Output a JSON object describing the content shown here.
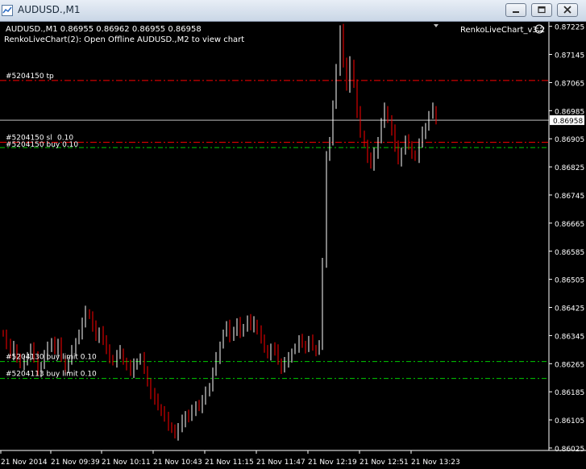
{
  "window": {
    "title": "AUDUSD.,M1",
    "buttons": [
      "minimize",
      "restore",
      "close"
    ]
  },
  "chart_header": {
    "symbol_line": "AUDUSD.,M1  0.86955 0.86962 0.86955 0.86958",
    "indicator_line": "RenkoLiveChart(2): Open Offline AUDUSD.,M2 to view chart",
    "ea_label": "RenkoLiveChart_v3.2",
    "ea_icon": "smiley-icon"
  },
  "colors": {
    "background": "#000000",
    "candle": "#ffffff",
    "candle_bear": "#ff0000",
    "tp_line": "#ff0000",
    "order_line": "#00cc00",
    "bid_line": "#c0c0c0",
    "bid_label_bg": "#ffffff"
  },
  "chart_data": {
    "type": "candlestick",
    "title": "AUDUSD.,M1",
    "y_ticks": [
      "0.87225",
      "0.87145",
      "0.87065",
      "0.86985",
      "0.86905",
      "0.86825",
      "0.86745",
      "0.86665",
      "0.86585",
      "0.86505",
      "0.86425",
      "0.86345",
      "0.86265",
      "0.86185",
      "0.86105",
      "0.86025"
    ],
    "x_ticks": [
      "21 Nov 2014",
      "21 Nov 09:39",
      "21 Nov 10:11",
      "21 Nov 10:43",
      "21 Nov 11:15",
      "21 Nov 11:47",
      "21 Nov 12:19",
      "21 Nov 12:51",
      "21 Nov 13:23"
    ],
    "ylim": [
      0.86018,
      0.87238
    ],
    "current_bid": "0.86958",
    "current_bid_value": 0.86958,
    "order_lines": [
      {
        "label": "#5204150 tp",
        "price": 0.87071,
        "kind": "tp"
      },
      {
        "label": "#5204150 sl",
        "price": 0.86895,
        "kind": "sl"
      },
      {
        "label": "#5204150 buy 0.10",
        "price": 0.8688,
        "kind": "order"
      },
      {
        "label": "#5204130 buy limit 0.10",
        "price": 0.86271,
        "kind": "pending"
      },
      {
        "label": "#5204113 buy limit 0.10",
        "price": 0.86223,
        "kind": "pending"
      }
    ],
    "sl_lot_text": "0.10",
    "close_series": [
      0.8635,
      0.8632,
      0.8629,
      0.8631,
      0.8628,
      0.8626,
      0.8627,
      0.8629,
      0.8631,
      0.8628,
      0.8624,
      0.8626,
      0.8629,
      0.8631,
      0.8633,
      0.863,
      0.8632,
      0.8628,
      0.8625,
      0.8627,
      0.863,
      0.8633,
      0.8635,
      0.8638,
      0.8641,
      0.864,
      0.8637,
      0.8634,
      0.8636,
      0.8633,
      0.863,
      0.8628,
      0.8627,
      0.8629,
      0.863,
      0.8627,
      0.8626,
      0.8624,
      0.8626,
      0.8627,
      0.8628,
      0.8625,
      0.8621,
      0.8618,
      0.8616,
      0.8614,
      0.8613,
      0.8611,
      0.8609,
      0.8608,
      0.8606,
      0.8608,
      0.861,
      0.8612,
      0.8611,
      0.8613,
      0.8615,
      0.8614,
      0.8616,
      0.8618,
      0.862,
      0.8624,
      0.8628,
      0.8632,
      0.8635,
      0.8637,
      0.8634,
      0.8636,
      0.8638,
      0.8635,
      0.8637,
      0.8639,
      0.8637,
      0.8638,
      0.8636,
      0.8633,
      0.8631,
      0.8629,
      0.8631,
      0.863,
      0.8627,
      0.8625,
      0.8627,
      0.8628,
      0.863,
      0.8631,
      0.8633,
      0.8632,
      0.8631,
      0.8633,
      0.8631,
      0.863,
      0.8632,
      0.8655,
      0.8685,
      0.869,
      0.87,
      0.871,
      0.8722,
      0.8712,
      0.8705,
      0.8712,
      0.8706,
      0.8698,
      0.8692,
      0.8689,
      0.8685,
      0.8683,
      0.8686,
      0.869,
      0.8695,
      0.8699,
      0.8696,
      0.8693,
      0.8688,
      0.8684,
      0.8687,
      0.869,
      0.8689,
      0.8686,
      0.8685,
      0.8689,
      0.8692,
      0.8694,
      0.8697,
      0.8699,
      0.8696
    ]
  }
}
